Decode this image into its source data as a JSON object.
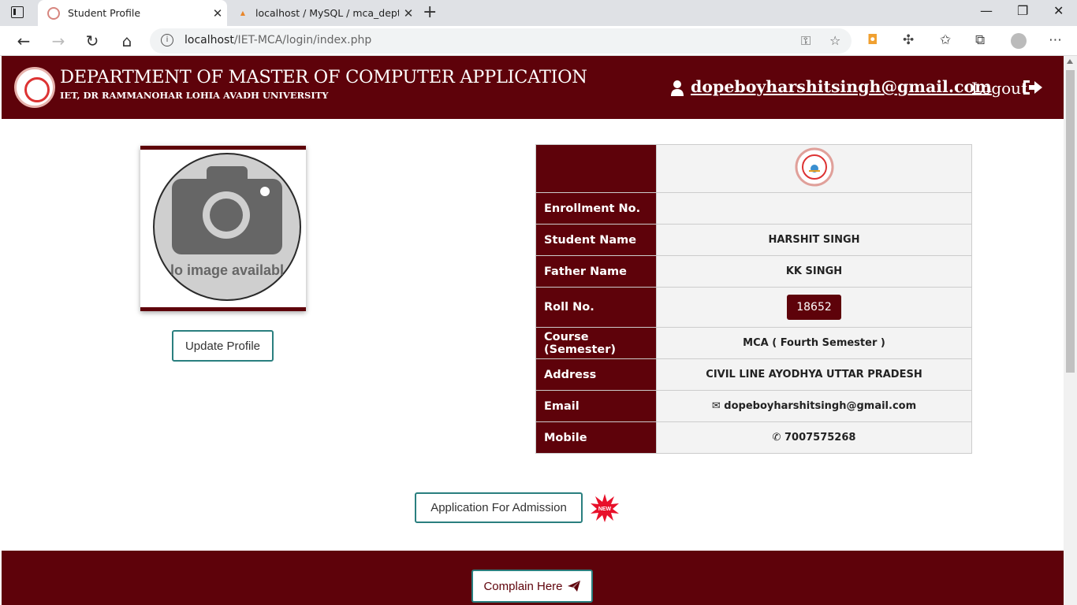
{
  "browser": {
    "tabs": [
      {
        "title": "Student Profile",
        "active": true
      },
      {
        "title": "localhost / MySQL / mca_dept / c",
        "active": false
      }
    ],
    "new_tab": "+",
    "address": {
      "host": "localhost",
      "path": "/IET-MCA/login/index.php"
    }
  },
  "header": {
    "title": "DEPARTMENT OF MASTER OF COMPUTER APPLICATION",
    "subtitle": "IET, DR RAMMANOHAR LOHIA AVADH UNIVERSITY",
    "user_email": "dopeboyharshitsingh@gmail.com",
    "logout_label": "Logout"
  },
  "profile": {
    "photo_placeholder_text": "lo image availabl",
    "update_button": "Update Profile"
  },
  "student": {
    "rows": [
      {
        "label": "Enrollment No.",
        "value": ""
      },
      {
        "label": "Student Name",
        "value": "HARSHIT SINGH"
      },
      {
        "label": "Father Name",
        "value": "KK SINGH"
      },
      {
        "label": "Roll No.",
        "value": "18652"
      },
      {
        "label": "Course (Semester)",
        "value": "MCA ( Fourth Semester )"
      },
      {
        "label": "Address",
        "value": "CIVIL LINE AYODHYA UTTAR PRADESH"
      },
      {
        "label": "Email",
        "value": "dopeboyharshitsingh@gmail.com"
      },
      {
        "label": "Mobile",
        "value": "7007575268"
      }
    ]
  },
  "actions": {
    "admission_button": "Application For Admission",
    "new_badge": "NEW",
    "complain_button": "Complain Here"
  },
  "colors": {
    "brand": "#5e020a",
    "button_border": "#2a7f7f"
  }
}
